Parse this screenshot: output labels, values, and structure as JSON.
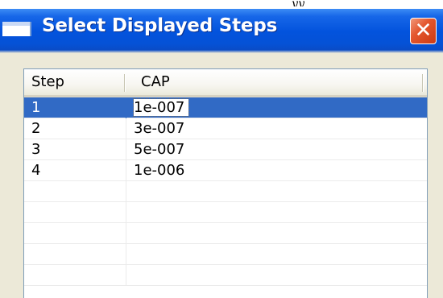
{
  "top_fragment": "ӯӯ",
  "window": {
    "title": "Select Displayed Steps",
    "close_glyph": "✕"
  },
  "list": {
    "columns": [
      "Step",
      "CAP"
    ],
    "rows": [
      {
        "step": "1",
        "cap": "1e-007",
        "selected": true
      },
      {
        "step": "2",
        "cap": "3e-007",
        "selected": false
      },
      {
        "step": "3",
        "cap": "5e-007",
        "selected": false
      },
      {
        "step": "4",
        "cap": "1e-006",
        "selected": false
      }
    ],
    "empty_row_count": 5
  },
  "colors": {
    "titlebar": "#0353dd",
    "selection": "#316ac5",
    "dialog_face": "#ece9d8",
    "close_button": "#e4572e"
  },
  "icons": {
    "window_icon": "window-icon",
    "close": "close-icon"
  }
}
